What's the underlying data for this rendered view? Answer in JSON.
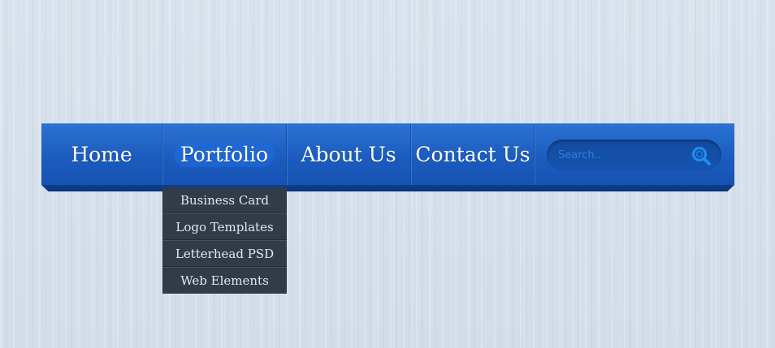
{
  "nav": {
    "items": [
      {
        "label": "Home"
      },
      {
        "label": "Portfolio"
      },
      {
        "label": "About Us"
      },
      {
        "label": "Contact Us"
      }
    ],
    "active_index": 1
  },
  "search": {
    "placeholder": "Search.."
  },
  "dropdown": {
    "items": [
      {
        "label": "Business Card"
      },
      {
        "label": "Logo Templates"
      },
      {
        "label": "Letterhead PSD"
      },
      {
        "label": "Web Elements"
      }
    ]
  },
  "colors": {
    "nav_blue": "#1c5cbf",
    "dropdown_bg": "#323c48",
    "search_icon": "#1e8ef0",
    "background": "#d5dfe9"
  },
  "icons": {
    "search": "search-icon"
  }
}
